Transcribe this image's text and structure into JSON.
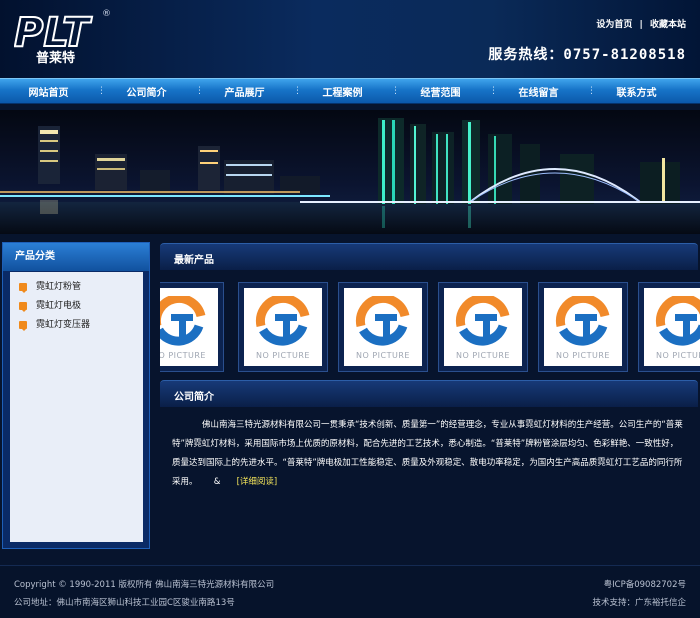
{
  "header": {
    "logo_text": "PLT",
    "logo_cn": "普莱特",
    "logo_mark": "®",
    "top_links": [
      "设为首页",
      "|",
      "收藏本站"
    ],
    "hotline_label": "服务热线：",
    "hotline_number": "0757-81208518"
  },
  "nav": {
    "items": [
      "网站首页",
      "公司简介",
      "产品展厅",
      "工程案例",
      "经营范围",
      "在线留言",
      "联系方式"
    ],
    "separator": "⋮"
  },
  "sidebar": {
    "title": "产品分类",
    "items": [
      "霓虹灯粉管",
      "霓虹灯电极",
      "霓虹灯变压器"
    ]
  },
  "products": {
    "title": "最新产品",
    "placeholder_text": "NO PICTURE",
    "cards": 6
  },
  "about": {
    "title": "公司简介",
    "text": "佛山南海三特光源材料有限公司一贯秉承“技术创新、质量第一”的经营理念，专业从事霓虹灯材料的生产经营。公司生产的“普莱特”牌霓虹灯材料，采用国际市场上优质的原材料，配合先进的工艺技术，悉心制造。“普莱特”牌粉管涂层均匀、色彩鲜艳、一致性好，质量达到国际上的先进水平。“普莱特”牌电极加工性能稳定、质量及外观稳定、散电功率稳定，为国内生产高品质霓虹灯工艺品的同行所采用。",
    "more_glyph": "&",
    "more_label": "[详细阅读]"
  },
  "footer": {
    "copyright": "Copyright © 1990-2011 版权所有  佛山南海三特光源材料有限公司",
    "icp": "粤ICP备09082702号",
    "address": "公司地址：佛山市南海区狮山科技工业园C区骏业南路13号",
    "support": "技术支持：广东裕托信企"
  },
  "colors": {
    "nav_blue": "#1774c8",
    "page_bg": "#07142d",
    "accent_orange": "#f08a1c",
    "link_yellow": "#f2e35a"
  }
}
